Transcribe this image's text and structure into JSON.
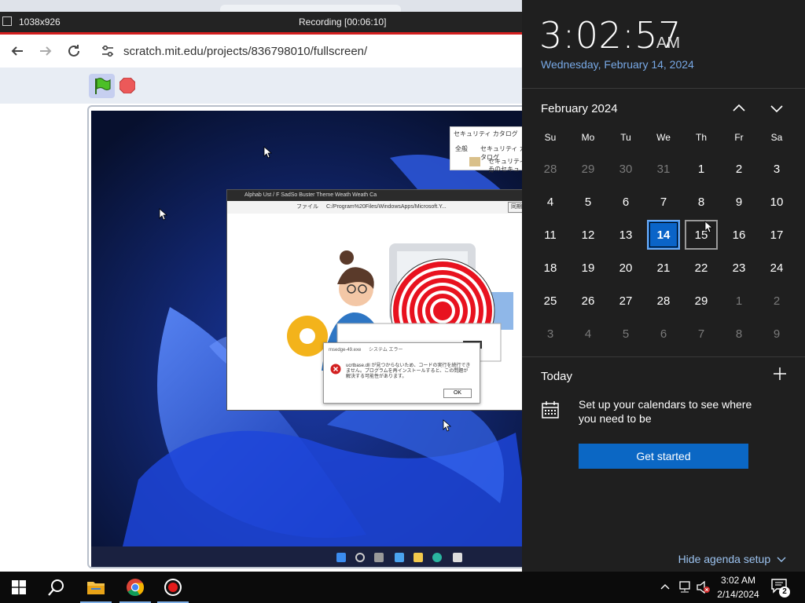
{
  "recording_bar": {
    "dimensions": "1038x926",
    "title": "Recording [00:06:10]"
  },
  "browser": {
    "url": "scratch.mit.edu/projects/836798010/fullscreen/",
    "back_icon": "back-arrow-icon",
    "forward_icon": "forward-arrow-icon",
    "reload_icon": "reload-icon"
  },
  "scratch": {
    "flag_icon": "green-flag-icon",
    "stop_icon": "stop-sign-icon"
  },
  "stage": {
    "dialog_title": "セキュリティ カタログ",
    "dialog_text_1": "全般",
    "dialog_text_2": "セキュリティ カタログ",
    "dialog_text_3": "セキュリティ カ",
    "dialog_text_4": "このセキュ",
    "inner_tabs": "Alphab  Ust / F  SadSo  Buster  Theme  Weath  Weath  Ca",
    "inner_addr_prefix": "ファイル",
    "inner_url": "C:/Program%20Files/WindowsApps/Microsoft.Y...",
    "inner_addr_tag": "同期し",
    "error_title_1": "msedge-49.exe",
    "error_title_2": "システム エラー",
    "error_message": "ucrtbase.dll が見つからないため、コードの実行を続行できません。プログラムを再インストールすると、この問題が解決する可能性があります。",
    "error_ok": "OK"
  },
  "clock": {
    "time": "3:02:57",
    "ampm": "AM",
    "date_long": "Wednesday, February 14, 2024"
  },
  "calendar": {
    "month_label": "February 2024",
    "weekdays": [
      "Su",
      "Mo",
      "Tu",
      "We",
      "Th",
      "Fr",
      "Sa"
    ],
    "days": [
      {
        "n": "28",
        "dim": true
      },
      {
        "n": "29",
        "dim": true
      },
      {
        "n": "30",
        "dim": true
      },
      {
        "n": "31",
        "dim": true
      },
      {
        "n": "1"
      },
      {
        "n": "2"
      },
      {
        "n": "3"
      },
      {
        "n": "4"
      },
      {
        "n": "5"
      },
      {
        "n": "6"
      },
      {
        "n": "7"
      },
      {
        "n": "8"
      },
      {
        "n": "9"
      },
      {
        "n": "10"
      },
      {
        "n": "11"
      },
      {
        "n": "12"
      },
      {
        "n": "13"
      },
      {
        "n": "14",
        "today": true
      },
      {
        "n": "15",
        "hover": true
      },
      {
        "n": "16"
      },
      {
        "n": "17"
      },
      {
        "n": "18"
      },
      {
        "n": "19"
      },
      {
        "n": "20"
      },
      {
        "n": "21"
      },
      {
        "n": "22"
      },
      {
        "n": "23"
      },
      {
        "n": "24"
      },
      {
        "n": "25"
      },
      {
        "n": "26"
      },
      {
        "n": "27"
      },
      {
        "n": "28"
      },
      {
        "n": "29"
      },
      {
        "n": "1",
        "dim": true
      },
      {
        "n": "2",
        "dim": true
      },
      {
        "n": "3",
        "dim": true
      },
      {
        "n": "4",
        "dim": true
      },
      {
        "n": "5",
        "dim": true
      },
      {
        "n": "6",
        "dim": true
      },
      {
        "n": "7",
        "dim": true
      },
      {
        "n": "8",
        "dim": true
      },
      {
        "n": "9",
        "dim": true
      }
    ]
  },
  "agenda": {
    "today_label": "Today",
    "setup_text": "Set up your calendars to see where you need to be",
    "get_started": "Get started",
    "hide_agenda": "Hide agenda setup"
  },
  "taskbar": {
    "time": "3:02 AM",
    "date": "2/14/2024",
    "notification_count": "2",
    "icons": [
      "windows-start-icon",
      "search-icon",
      "file-explorer-icon",
      "chrome-icon",
      "record-icon"
    ]
  },
  "colors": {
    "accent": "#0b67c4",
    "today_highlight": "#0a64c8",
    "date_link": "#78a9e6",
    "flyout_bg": "#1f1f1f"
  }
}
